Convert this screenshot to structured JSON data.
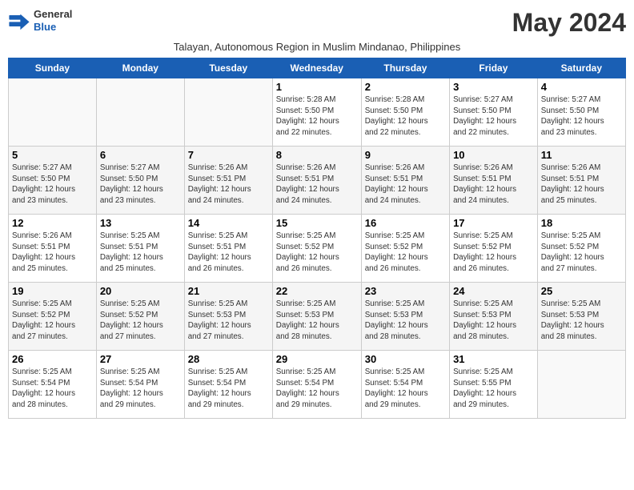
{
  "header": {
    "logo_general": "General",
    "logo_blue": "Blue",
    "month_title": "May 2024",
    "subtitle": "Talayan, Autonomous Region in Muslim Mindanao, Philippines"
  },
  "days_of_week": [
    "Sunday",
    "Monday",
    "Tuesday",
    "Wednesday",
    "Thursday",
    "Friday",
    "Saturday"
  ],
  "weeks": [
    [
      {
        "day": "",
        "info": ""
      },
      {
        "day": "",
        "info": ""
      },
      {
        "day": "",
        "info": ""
      },
      {
        "day": "1",
        "info": "Sunrise: 5:28 AM\nSunset: 5:50 PM\nDaylight: 12 hours\nand 22 minutes."
      },
      {
        "day": "2",
        "info": "Sunrise: 5:28 AM\nSunset: 5:50 PM\nDaylight: 12 hours\nand 22 minutes."
      },
      {
        "day": "3",
        "info": "Sunrise: 5:27 AM\nSunset: 5:50 PM\nDaylight: 12 hours\nand 22 minutes."
      },
      {
        "day": "4",
        "info": "Sunrise: 5:27 AM\nSunset: 5:50 PM\nDaylight: 12 hours\nand 23 minutes."
      }
    ],
    [
      {
        "day": "5",
        "info": "Sunrise: 5:27 AM\nSunset: 5:50 PM\nDaylight: 12 hours\nand 23 minutes."
      },
      {
        "day": "6",
        "info": "Sunrise: 5:27 AM\nSunset: 5:50 PM\nDaylight: 12 hours\nand 23 minutes."
      },
      {
        "day": "7",
        "info": "Sunrise: 5:26 AM\nSunset: 5:51 PM\nDaylight: 12 hours\nand 24 minutes."
      },
      {
        "day": "8",
        "info": "Sunrise: 5:26 AM\nSunset: 5:51 PM\nDaylight: 12 hours\nand 24 minutes."
      },
      {
        "day": "9",
        "info": "Sunrise: 5:26 AM\nSunset: 5:51 PM\nDaylight: 12 hours\nand 24 minutes."
      },
      {
        "day": "10",
        "info": "Sunrise: 5:26 AM\nSunset: 5:51 PM\nDaylight: 12 hours\nand 24 minutes."
      },
      {
        "day": "11",
        "info": "Sunrise: 5:26 AM\nSunset: 5:51 PM\nDaylight: 12 hours\nand 25 minutes."
      }
    ],
    [
      {
        "day": "12",
        "info": "Sunrise: 5:26 AM\nSunset: 5:51 PM\nDaylight: 12 hours\nand 25 minutes."
      },
      {
        "day": "13",
        "info": "Sunrise: 5:25 AM\nSunset: 5:51 PM\nDaylight: 12 hours\nand 25 minutes."
      },
      {
        "day": "14",
        "info": "Sunrise: 5:25 AM\nSunset: 5:51 PM\nDaylight: 12 hours\nand 26 minutes."
      },
      {
        "day": "15",
        "info": "Sunrise: 5:25 AM\nSunset: 5:52 PM\nDaylight: 12 hours\nand 26 minutes."
      },
      {
        "day": "16",
        "info": "Sunrise: 5:25 AM\nSunset: 5:52 PM\nDaylight: 12 hours\nand 26 minutes."
      },
      {
        "day": "17",
        "info": "Sunrise: 5:25 AM\nSunset: 5:52 PM\nDaylight: 12 hours\nand 26 minutes."
      },
      {
        "day": "18",
        "info": "Sunrise: 5:25 AM\nSunset: 5:52 PM\nDaylight: 12 hours\nand 27 minutes."
      }
    ],
    [
      {
        "day": "19",
        "info": "Sunrise: 5:25 AM\nSunset: 5:52 PM\nDaylight: 12 hours\nand 27 minutes."
      },
      {
        "day": "20",
        "info": "Sunrise: 5:25 AM\nSunset: 5:52 PM\nDaylight: 12 hours\nand 27 minutes."
      },
      {
        "day": "21",
        "info": "Sunrise: 5:25 AM\nSunset: 5:53 PM\nDaylight: 12 hours\nand 27 minutes."
      },
      {
        "day": "22",
        "info": "Sunrise: 5:25 AM\nSunset: 5:53 PM\nDaylight: 12 hours\nand 28 minutes."
      },
      {
        "day": "23",
        "info": "Sunrise: 5:25 AM\nSunset: 5:53 PM\nDaylight: 12 hours\nand 28 minutes."
      },
      {
        "day": "24",
        "info": "Sunrise: 5:25 AM\nSunset: 5:53 PM\nDaylight: 12 hours\nand 28 minutes."
      },
      {
        "day": "25",
        "info": "Sunrise: 5:25 AM\nSunset: 5:53 PM\nDaylight: 12 hours\nand 28 minutes."
      }
    ],
    [
      {
        "day": "26",
        "info": "Sunrise: 5:25 AM\nSunset: 5:54 PM\nDaylight: 12 hours\nand 28 minutes."
      },
      {
        "day": "27",
        "info": "Sunrise: 5:25 AM\nSunset: 5:54 PM\nDaylight: 12 hours\nand 29 minutes."
      },
      {
        "day": "28",
        "info": "Sunrise: 5:25 AM\nSunset: 5:54 PM\nDaylight: 12 hours\nand 29 minutes."
      },
      {
        "day": "29",
        "info": "Sunrise: 5:25 AM\nSunset: 5:54 PM\nDaylight: 12 hours\nand 29 minutes."
      },
      {
        "day": "30",
        "info": "Sunrise: 5:25 AM\nSunset: 5:54 PM\nDaylight: 12 hours\nand 29 minutes."
      },
      {
        "day": "31",
        "info": "Sunrise: 5:25 AM\nSunset: 5:55 PM\nDaylight: 12 hours\nand 29 minutes."
      },
      {
        "day": "",
        "info": ""
      }
    ]
  ]
}
